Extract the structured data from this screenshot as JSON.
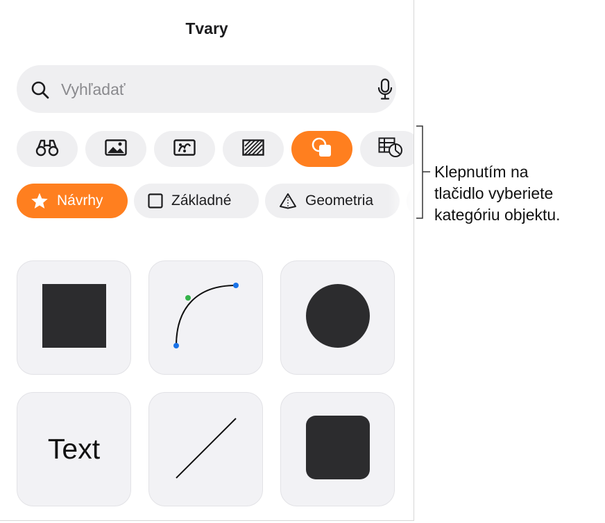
{
  "panel": {
    "title": "Tvary",
    "search": {
      "placeholder": "Vyhľadať",
      "value": ""
    },
    "category_buttons": [
      {
        "icon": "binoculars-icon",
        "active": false
      },
      {
        "icon": "image-icon",
        "active": false
      },
      {
        "icon": "sticker-icon",
        "active": false
      },
      {
        "icon": "texture-icon",
        "active": false
      },
      {
        "icon": "shapes-icon",
        "active": true
      },
      {
        "icon": "table-chart-icon",
        "active": false
      }
    ],
    "subcategories": [
      {
        "label": "Návrhy",
        "icon": "star-icon",
        "active": true
      },
      {
        "label": "Základné",
        "icon": "square-outline-icon",
        "active": false
      },
      {
        "label": "Geometria",
        "icon": "pyramid-icon",
        "active": false
      }
    ],
    "shapes": [
      {
        "name": "square"
      },
      {
        "name": "curve"
      },
      {
        "name": "circle"
      },
      {
        "name": "text",
        "label": "Text"
      },
      {
        "name": "line"
      },
      {
        "name": "rounded-square"
      }
    ],
    "accent_color": "#ff7f1f"
  },
  "callout": {
    "lines": [
      "Klepnutím na",
      "tlačidlo vyberiete",
      "kategóriu objektu."
    ]
  }
}
